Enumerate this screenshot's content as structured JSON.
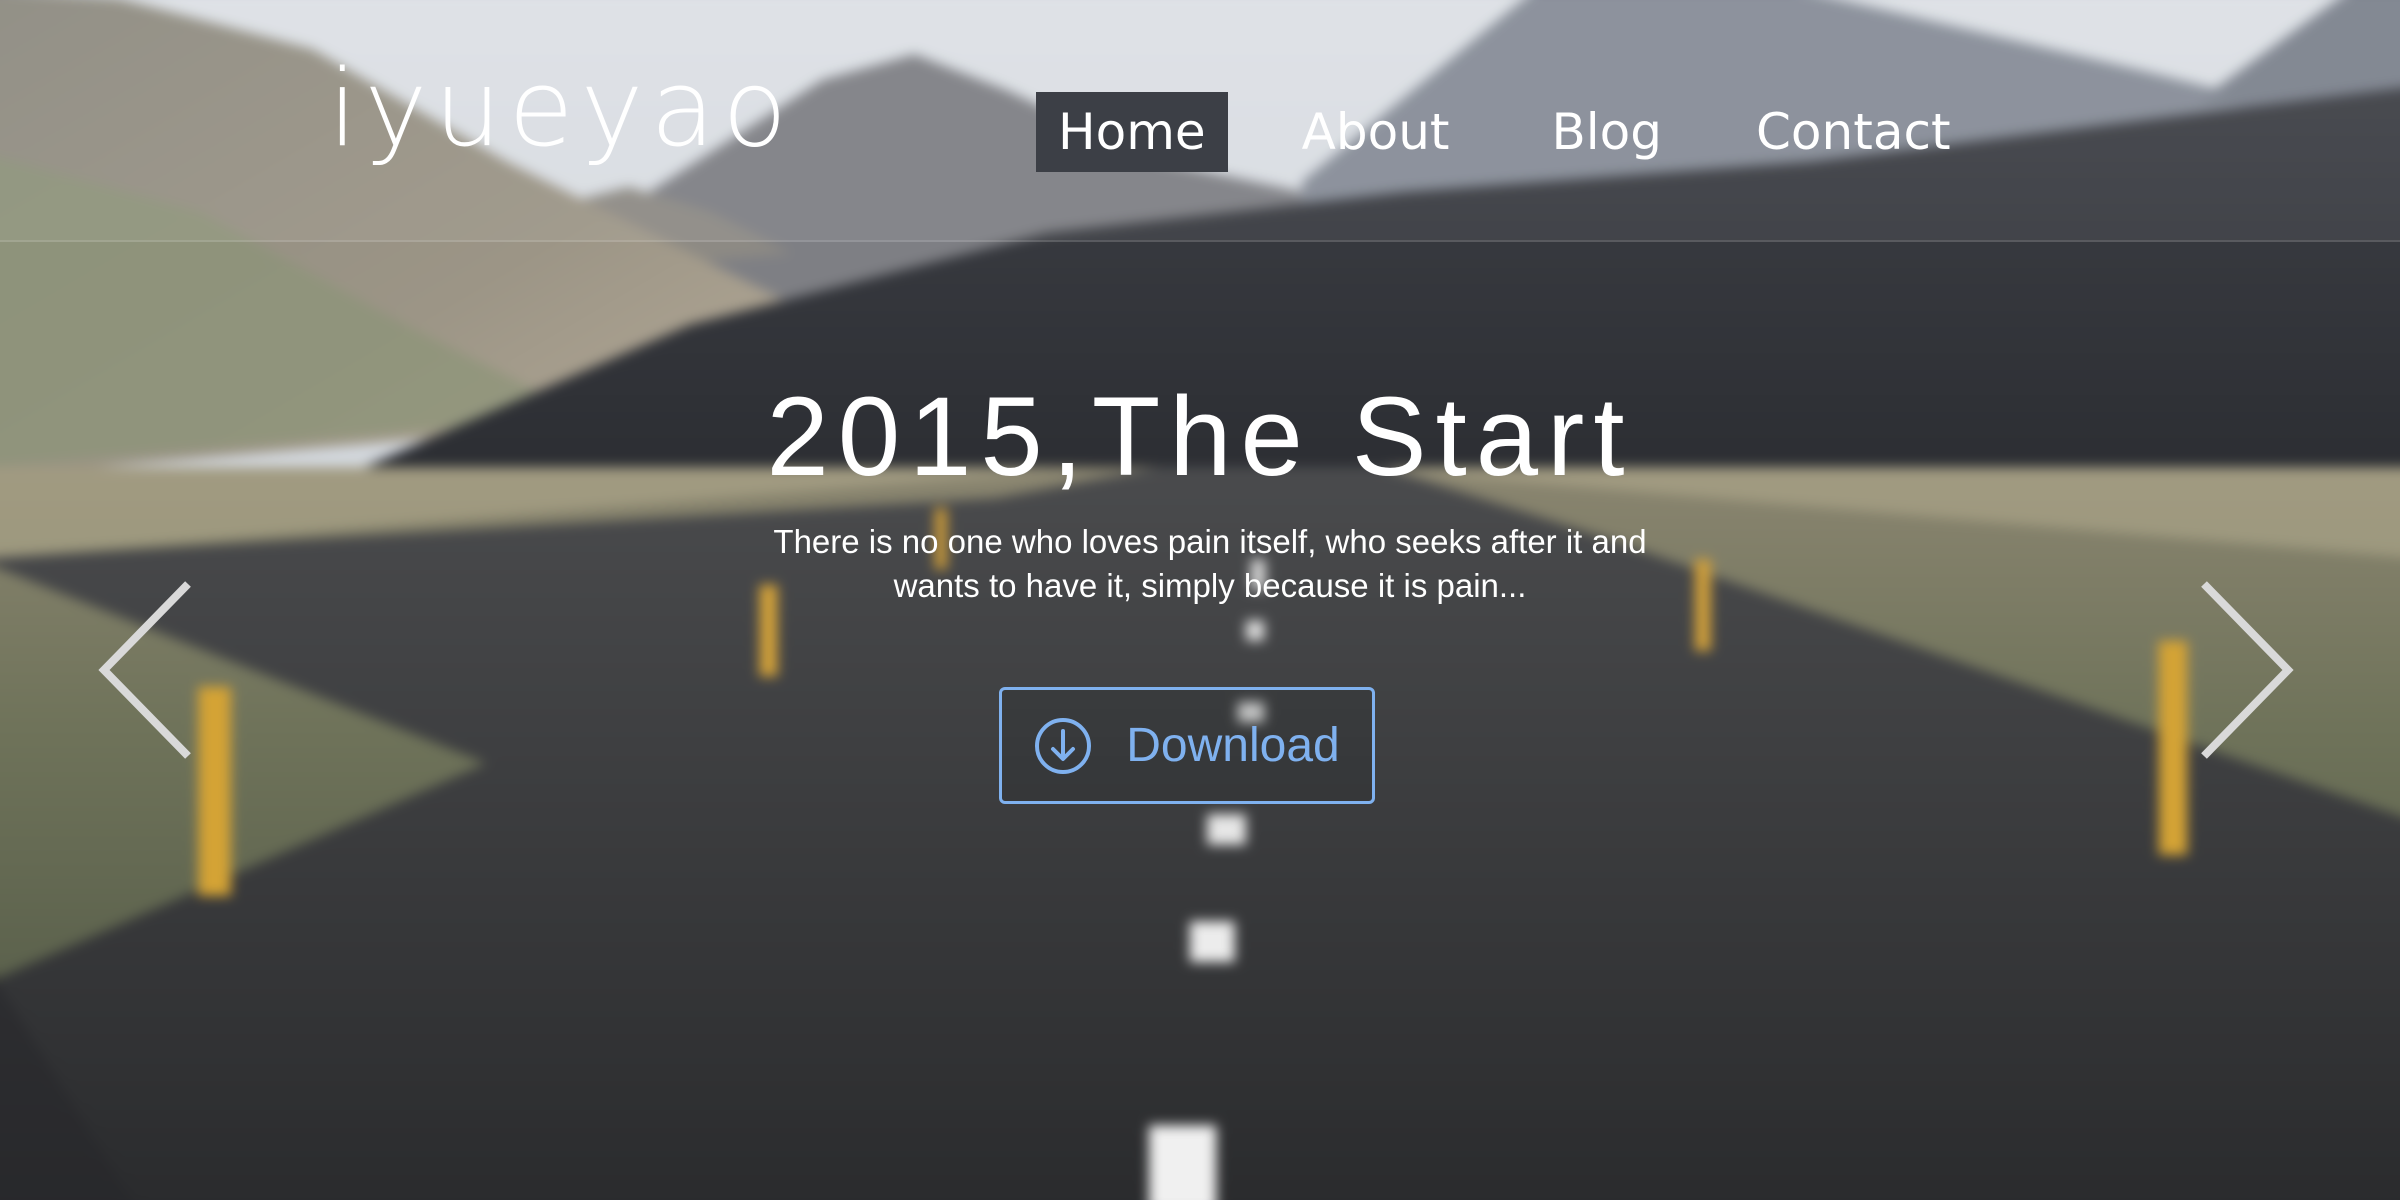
{
  "header": {
    "logo": "iyueyao",
    "nav": [
      {
        "label": "Home",
        "active": true
      },
      {
        "label": "About",
        "active": false
      },
      {
        "label": "Blog",
        "active": false
      },
      {
        "label": "Contact",
        "active": false
      }
    ]
  },
  "hero": {
    "title": "2015,The Start",
    "subtitle": "There is no one who loves pain itself, who seeks after it and wants to have it, simply because it is pain...",
    "download_label": "Download",
    "download_icon": "arrow-down-circle-icon",
    "prev_icon": "chevron-left-icon",
    "next_icon": "chevron-right-icon"
  },
  "colors": {
    "accent": "#7fb1ef",
    "nav_active_bg": "#3c3f46",
    "text": "#ffffff"
  }
}
